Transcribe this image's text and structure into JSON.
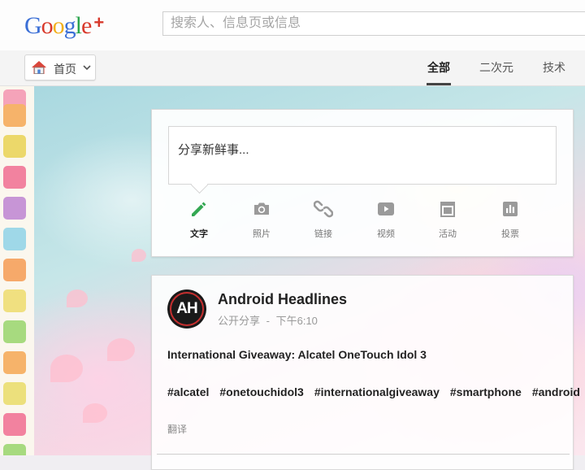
{
  "header": {
    "logo": {
      "text": "Google",
      "plus": "+"
    },
    "search": {
      "placeholder": "搜索人、信息页或信息",
      "value": ""
    }
  },
  "nav": {
    "home_label": "首页",
    "tabs": [
      {
        "label": "全部",
        "active": true
      },
      {
        "label": "二次元",
        "active": false
      },
      {
        "label": "技术",
        "active": false
      }
    ]
  },
  "share": {
    "placeholder": "分享新鲜事...",
    "options": [
      {
        "label": "文字",
        "icon": "pencil-icon",
        "active": true
      },
      {
        "label": "照片",
        "icon": "camera-icon",
        "active": false
      },
      {
        "label": "链接",
        "icon": "link-icon",
        "active": false
      },
      {
        "label": "视频",
        "icon": "video-icon",
        "active": false
      },
      {
        "label": "活动",
        "icon": "calendar-icon",
        "active": false
      },
      {
        "label": "投票",
        "icon": "poll-icon",
        "active": false
      }
    ]
  },
  "post": {
    "avatar_text": "AH",
    "author": "Android Headlines",
    "visibility": "公开分享",
    "separator": "-",
    "time": "下午6:10",
    "title": "International Giveaway: Alcatel OneTouch Idol 3",
    "hashtags": [
      "#alcatel",
      "#onetouchidol3",
      "#internationalgiveaway",
      "#smartphone",
      "#android"
    ],
    "translate": "翻译"
  },
  "colors": {
    "accent_green": "#34a853",
    "google_blue": "#3b6fd6",
    "google_red": "#d8392b"
  }
}
